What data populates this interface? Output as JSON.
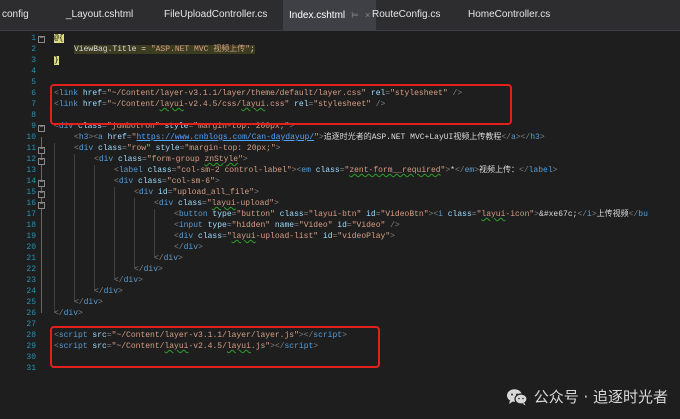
{
  "tabs": [
    {
      "label": "config",
      "active": false
    },
    {
      "label": "_Layout.cshtml",
      "active": false
    },
    {
      "label": "FileUploadController.cs",
      "active": false
    },
    {
      "label": "Index.cshtml",
      "active": true,
      "pin": "⊨",
      "close": "×"
    },
    {
      "label": "RouteConfig.cs",
      "active": false
    },
    {
      "label": "HomeController.cs",
      "active": false
    }
  ],
  "line_numbers": [
    "1",
    "2",
    "3",
    "4",
    "5",
    "6",
    "7",
    "8",
    "9",
    "10",
    "11",
    "12",
    "13",
    "14",
    "15",
    "16",
    "17",
    "18",
    "19",
    "20",
    "21",
    "22",
    "23",
    "24",
    "25",
    "26",
    "27",
    "28",
    "29",
    "30",
    "31"
  ],
  "fold_markers": [
    "−",
    "−",
    "−",
    "−",
    "−",
    "−",
    "−"
  ],
  "code": {
    "l1_at": "@{",
    "l2": {
      "var": "ViewBag.Title",
      "eq": " = ",
      "val": "\"ASP.NET MVC 视频上传\"",
      "semi": ";"
    },
    "l3_close": "}",
    "l6": {
      "open": "<",
      "tag": "link",
      "a1": " href",
      "eq1": "=",
      "v1": "\"~/Content/layer-v3.1.1/layer/theme/default/layer.css\"",
      "a2": " rel",
      "eq2": "=",
      "v2": "\"stylesheet\"",
      "close": " />"
    },
    "l7": {
      "open": "<",
      "tag": "link",
      "a1": " href",
      "eq1": "=",
      "v1a": "\"~/Content/",
      "v1b": "layui",
      "v1c": "-v2.4.5/css/",
      "v1d": "layui",
      "v1e": ".css\"",
      "a2": " rel",
      "eq2": "=",
      "v2": "\"stylesheet\"",
      "close": " />"
    },
    "l9": {
      "open": "<",
      "tag": "div",
      "a1": " class",
      "eq1": "=",
      "v1": "\"jumbotron\"",
      "a2": " style",
      "eq2": "=",
      "v2": "\"margin-top: 200px;\"",
      "close": ">"
    },
    "l10": {
      "o1": "<",
      "t1": "h3",
      "c1": "><",
      "t2": "a",
      "a1": " href",
      "eq1": "=",
      "v1q": "\"",
      "url": "https://www.cnblogs.com/Can-daydayup/",
      "v1q2": "\"",
      "c2": ">",
      "text": "追逐时光者的ASP.NET MVC+LayUI视频上传教程",
      "o3": "</",
      "t3": "a",
      "c3": "></",
      "t4": "h3",
      "c4": ">"
    },
    "l11": {
      "open": "<",
      "tag": "div",
      "a1": " class",
      "eq1": "=",
      "v1": "\"row\"",
      "a2": " style",
      "eq2": "=",
      "v2": "\"margin-top: 20px;\"",
      "close": ">"
    },
    "l12": {
      "open": "<",
      "tag": "div",
      "a1": " class",
      "eq1": "=",
      "v1a": "\"form-group ",
      "v1b": "znStyle",
      "v1c": "\"",
      "close": ">"
    },
    "l13": {
      "open": "<",
      "tag": "label",
      "a1": " class",
      "eq1": "=",
      "v1": "\"col-sm-2 control-label\"",
      "c1": "><",
      "t2": "em",
      "a2": " class",
      "eq2": "=",
      "v2a": "\"",
      "v2b": "zent-form__required",
      "v2c": "\"",
      "c2": ">",
      "star": "*",
      "o3": "</",
      "t3": "em",
      "c3": ">",
      "text": "视频上传：",
      "o4": "</",
      "t4": "label",
      "c4": ">"
    },
    "l14": {
      "open": "<",
      "tag": "div",
      "a1": " class",
      "eq1": "=",
      "v1": "\"col-sm-6\"",
      "close": ">"
    },
    "l15": {
      "open": "<",
      "tag": "div",
      "a1": " id",
      "eq1": "=",
      "v1": "\"upload_all_file\"",
      "close": ">"
    },
    "l16": {
      "open": "<",
      "tag": "div",
      "a1": " class",
      "eq1": "=",
      "v1a": "\"",
      "v1b": "layui",
      "v1c": "-upload\"",
      "close": ">"
    },
    "l17": {
      "open": "<",
      "tag": "button",
      "a1": " type",
      "eq1": "=",
      "v1": "\"button\"",
      "a2": " class",
      "eq2": "=",
      "v2": "\"layui-btn\"",
      "a3": " id",
      "eq3": "=",
      "v3": "\"VideoBtn\"",
      "c1": "><",
      "t2": "i",
      "a4": " class",
      "eq4": "=",
      "v4a": "\"",
      "v4b": "layui",
      "v4c": "-icon\"",
      "c2": ">",
      "ent": "&#xe67c;",
      "o3": "</",
      "t3": "i",
      "c3": ">",
      "text": "上传视频",
      "o4": "</",
      "t4": "bu"
    },
    "l18": {
      "open": "<",
      "tag": "input",
      "a1": " type",
      "eq1": "=",
      "v1": "\"hidden\"",
      "a2": " name",
      "eq2": "=",
      "v2": "\"Video\"",
      "a3": " id",
      "eq3": "=",
      "v3": "\"Video\"",
      "close": " />"
    },
    "l19": {
      "open": "<",
      "tag": "div",
      "a1": " class",
      "eq1": "=",
      "v1a": "\"",
      "v1b": "layui",
      "v1c": "-upload-list\"",
      "a2": " id",
      "eq2": "=",
      "v2": "\"videoPlay\"",
      "close": ">"
    },
    "l20": {
      "open": "</",
      "tag": "div",
      "close": ">"
    },
    "l21": {
      "open": "</",
      "tag": "div",
      "close": ">"
    },
    "l22": {
      "open": "</",
      "tag": "div",
      "close": ">"
    },
    "l23": {
      "open": "</",
      "tag": "div",
      "close": ">"
    },
    "l24": {
      "open": "</",
      "tag": "div",
      "close": ">"
    },
    "l25": {
      "open": "</",
      "tag": "div",
      "close": ">"
    },
    "l26": {
      "open": "</",
      "tag": "div",
      "close": ">"
    },
    "l28": {
      "open": "<",
      "tag": "script",
      "a1": " src",
      "eq1": "=",
      "v1": "\"~/Content/layer-v3.1.1/layer/layer.js\"",
      "c1": "></",
      "t2": "script",
      "c2": ">"
    },
    "l29": {
      "open": "<",
      "tag": "script",
      "a1": " src",
      "eq1": "=",
      "v1a": "\"~/Content/",
      "v1b": "layui",
      "v1c": "-v2.4.5/",
      "v1d": "layui",
      "v1e": ".js\"",
      "c1": "></",
      "t2": "script",
      "c2": ">"
    }
  },
  "watermark": {
    "text": "公众号 · 追逐时光者",
    "icon": "wechat-icon"
  },
  "colors": {
    "highlight_box": "#e3201b",
    "background": "#1e1e1e",
    "line_number": "#2b91af"
  }
}
